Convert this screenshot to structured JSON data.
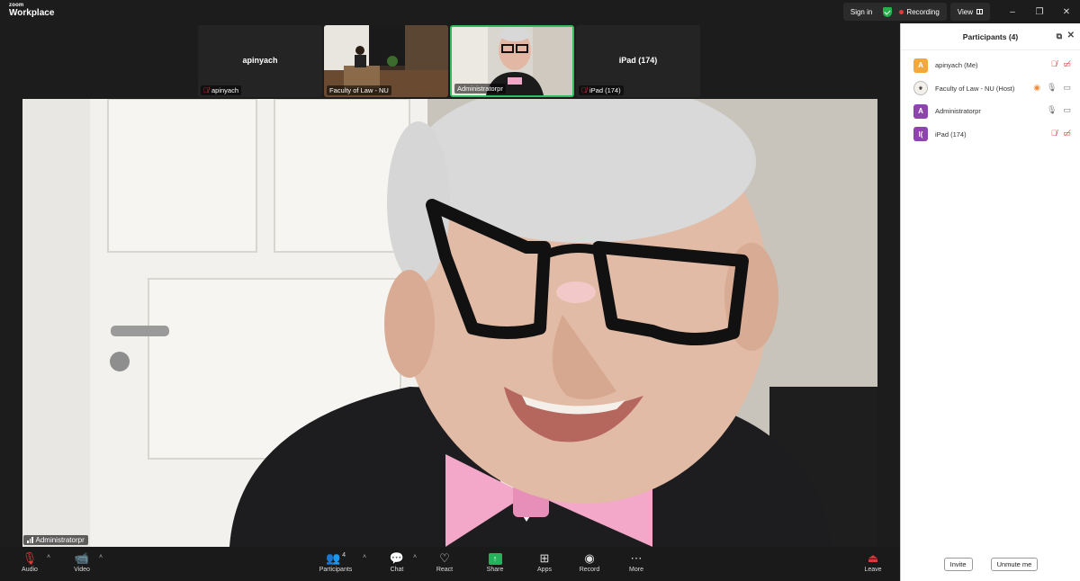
{
  "app": {
    "brand_top": "zoom",
    "brand_bottom": "Workplace"
  },
  "titlebar": {
    "sign_in": "Sign in",
    "recording": "Recording",
    "view": "View",
    "minimize": "–",
    "restore": "❐",
    "close": "✕"
  },
  "thumbnails": [
    {
      "center_name": "apinyach",
      "label": "apinyach",
      "muted": true
    },
    {
      "center_name": "",
      "label": "Faculty of Law - NU",
      "muted": false
    },
    {
      "center_name": "",
      "label": "Administratorpr",
      "muted": false
    },
    {
      "center_name": "iPad (174)",
      "label": "iPad (174)",
      "muted": true
    }
  ],
  "main_video": {
    "speaker_label": "Administratorpr"
  },
  "toolbar": {
    "audio": "Audio",
    "video": "Video",
    "participants": "Participants",
    "participants_count": "4",
    "chat": "Chat",
    "react": "React",
    "share": "Share",
    "apps": "Apps",
    "record": "Record",
    "more": "More",
    "leave": "Leave"
  },
  "panel": {
    "title": "Participants (4)",
    "participants": [
      {
        "initial": "A",
        "name": "apinyach (Me)",
        "color": "#f2a83a"
      },
      {
        "initial": "",
        "name": "Faculty of Law - NU (Host)",
        "color": "#f3f0ea"
      },
      {
        "initial": "A",
        "name": "Administratorpr",
        "color": "#8e44ad"
      },
      {
        "initial": "I(",
        "name": "iPad (174)",
        "color": "#8e44ad"
      }
    ],
    "invite": "Invite",
    "unmute_me": "Unmute me"
  }
}
